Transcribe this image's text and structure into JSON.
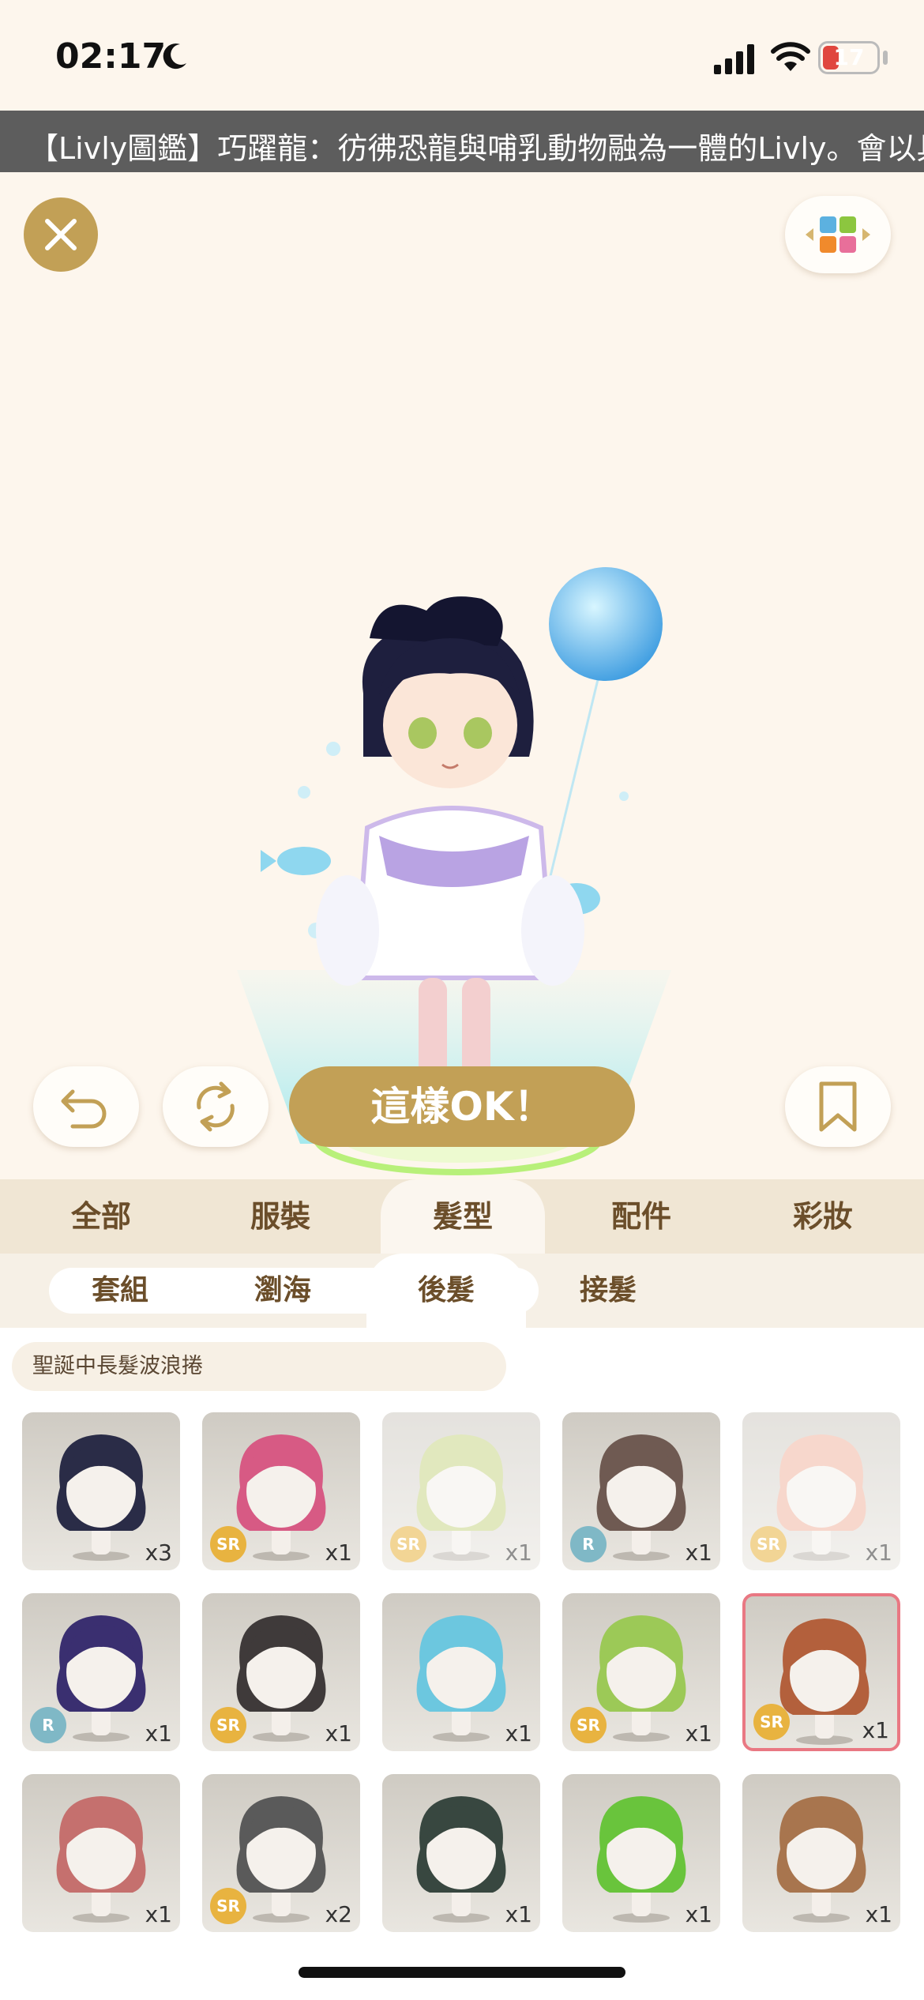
{
  "status": {
    "time": "02:17",
    "battery": "17"
  },
  "ticker": "【Livly圖鑑】巧躍龍：彷彿恐龍與哺乳動物融為一體的Livly。會以具",
  "actions": {
    "ok_label": "這樣OK！"
  },
  "main_tabs": [
    "全部",
    "服裝",
    "髮型",
    "配件",
    "彩妝"
  ],
  "main_tab_active": "髮型",
  "sub_tabs": [
    "套組",
    "瀏海",
    "後髮",
    "接髮"
  ],
  "sub_tab_active": "後髮",
  "selected_item_name": "聖誕中長髮波浪捲",
  "items": [
    {
      "hair": "navy bob",
      "rarity": "",
      "qty": "x3"
    },
    {
      "hair": "pink long wavy",
      "rarity": "SR",
      "qty": "x1"
    },
    {
      "hair": "lime wavy",
      "rarity": "SR",
      "qty": "x1"
    },
    {
      "hair": "brown short",
      "rarity": "R",
      "qty": "x1"
    },
    {
      "hair": "peach twin",
      "rarity": "SR",
      "qty": "x1"
    },
    {
      "hair": "purple long",
      "rarity": "R",
      "qty": "x1"
    },
    {
      "hair": "dark pigtails",
      "rarity": "SR",
      "qty": "x1"
    },
    {
      "hair": "blue bob",
      "rarity": "",
      "qty": "x1"
    },
    {
      "hair": "green wavy",
      "rarity": "SR",
      "qty": "x1"
    },
    {
      "hair": "auburn wavy",
      "rarity": "SR",
      "qty": "x1"
    },
    {
      "hair": "rose short",
      "rarity": "",
      "qty": "x1"
    },
    {
      "hair": "grey layered",
      "rarity": "SR",
      "qty": "x2"
    },
    {
      "hair": "dark green spiky",
      "rarity": "",
      "qty": "x1"
    },
    {
      "hair": "green floral",
      "rarity": "",
      "qty": "x1"
    },
    {
      "hair": "brown side",
      "rarity": "",
      "qty": "x1"
    }
  ],
  "colors": {
    "gold": "#c2a056",
    "selected_border": "#e97883",
    "sr": "#e8b340",
    "r": "#7fb8c6"
  }
}
